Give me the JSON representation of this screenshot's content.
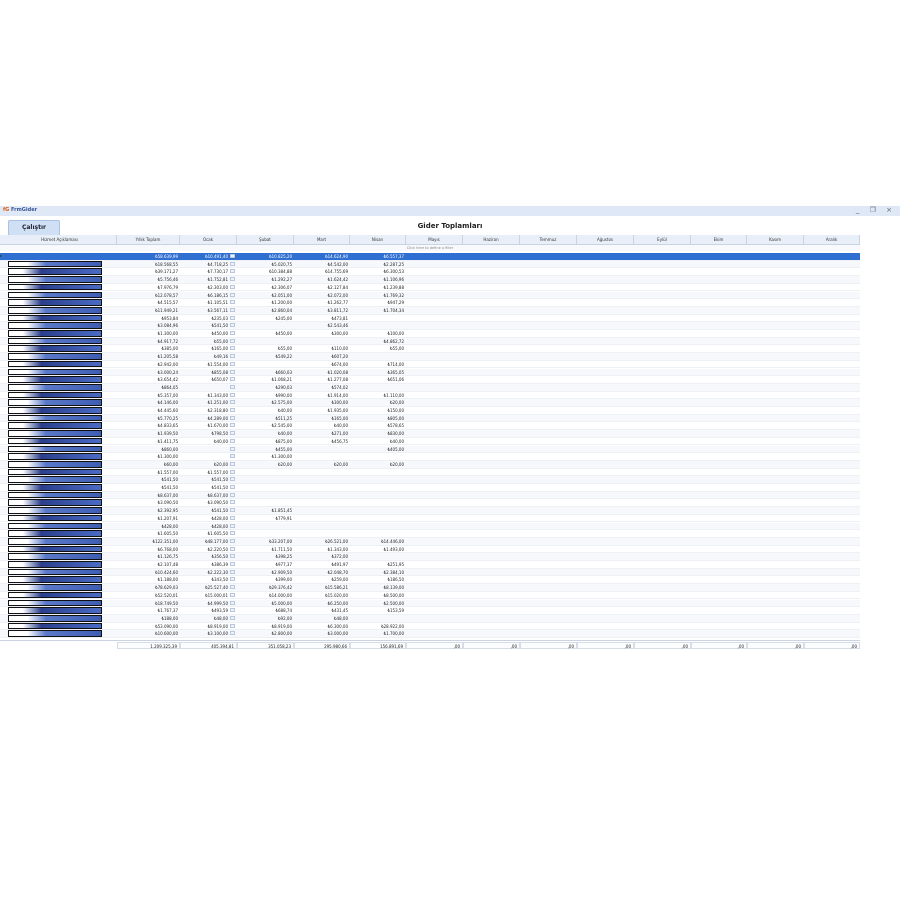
{
  "window": {
    "app_title": "FrmGider",
    "controls": "_ ❐ ×"
  },
  "toolbar": {
    "run_label": "Çalıştır",
    "report_title": "Gider Toplamları"
  },
  "grid": {
    "filter_hint": "Click here to define a filter",
    "columns": [
      "Hizmet Açıklaması",
      "Yıllık Toplam",
      "Ocak",
      "Şubat",
      "Mart",
      "Nisan",
      "Mayıs",
      "Haziran",
      "Temmuz",
      "Ağustos",
      "Eylül",
      "Ekim",
      "Kasım",
      "Aralık"
    ],
    "rows": [
      [
        "₺58.639,99",
        "₺10.491,40",
        "₺10.825,20",
        "₺14.624,90",
        "₺6.557,37"
      ],
      [
        "₺18.568,55",
        "₺4.718,25",
        "₺5.020,75",
        "₺4.542,00",
        "₺2.287,25"
      ],
      [
        "₺39.171,27",
        "₺7.730,17",
        "₺10.384,88",
        "₺14.755,69",
        "₺6.300,53"
      ],
      [
        "₺5.756,46",
        "₺1.752,81",
        "₺1.292,27",
        "₺1.624,42",
        "₺1.106,96"
      ],
      [
        "₺7.976,79",
        "₺2.303,00",
        "₺2.306,07",
        "₺2.127,84",
        "₺1.239,88"
      ],
      [
        "₺12.078,57",
        "₺6.186,15",
        "₺2.051,00",
        "₺2.072,00",
        "₺1.769,32"
      ],
      [
        "₺4.515,57",
        "₺1.105,51",
        "₺1.200,00",
        "₺1.262,77",
        "₺947,29"
      ],
      [
        "₺11.949,21",
        "₺3.567,11",
        "₺2.860,04",
        "₺3.811,72",
        "₺1.704,34"
      ],
      [
        "₺953,84",
        "₺235,03",
        "₺245,00",
        "₺473,81",
        ""
      ],
      [
        "₺3.084,96",
        "₺541,50",
        "",
        "₺2.543,46",
        ""
      ],
      [
        "₺1.300,00",
        "₺450,00",
        "₺450,00",
        "₺300,00",
        "₺100,00"
      ],
      [
        "₺4.917,72",
        "₺55,00",
        "",
        "",
        "₺4.862,72"
      ],
      [
        "₺385,00",
        "₺165,00",
        "₺55,00",
        "₺110,00",
        "₺55,00"
      ],
      [
        "₺1.205,58",
        "₺49,16",
        "₺549,22",
        "₺607,20",
        ""
      ],
      [
        "₺2.942,00",
        "₺1.554,00",
        "",
        "₺674,00",
        "₺714,00"
      ],
      [
        "₺3.000,24",
        "₺855,08",
        "₺660,03",
        "₺1.020,08",
        "₺365,05"
      ],
      [
        "₺3.654,42",
        "₺650,07",
        "₺1.068,21",
        "₺1.277,08",
        "₺651,06"
      ],
      [
        "₺864,05",
        "",
        "₺290,03",
        "₺574,02",
        ""
      ],
      [
        "₺5.357,00",
        "₺1.343,00",
        "₺990,00",
        "₺1.914,00",
        "₺1.110,00"
      ],
      [
        "₺4.146,00",
        "₺1.251,00",
        "₺2.575,00",
        "₺300,00",
        "₺20,00"
      ],
      [
        "₺4.445,60",
        "₺2.318,80",
        "₺40,00",
        "₺1.935,00",
        "₺150,00"
      ],
      [
        "₺5.770,25",
        "₺4.289,00",
        "₺511,25",
        "₺165,00",
        "₺805,00"
      ],
      [
        "₺4.833,65",
        "₺1.670,00",
        "₺2.545,00",
        "₺40,00",
        "₺578,65"
      ],
      [
        "₺1.939,50",
        "₺798,50",
        "₺40,00",
        "₺271,00",
        "₺830,00"
      ],
      [
        "₺1.411,75",
        "₺40,00",
        "₺875,00",
        "₺456,75",
        "₺40,00"
      ],
      [
        "₺860,00",
        "",
        "₺455,00",
        "",
        "₺405,00"
      ],
      [
        "₺1.300,00",
        "",
        "₺1.300,00",
        "",
        ""
      ],
      [
        "₺60,00",
        "₺20,00",
        "₺20,00",
        "₺20,00",
        "₺20,00"
      ],
      [
        "₺1.557,00",
        "₺1.557,00",
        "",
        "",
        ""
      ],
      [
        "₺541,50",
        "₺541,50",
        "",
        "",
        ""
      ],
      [
        "₺541,50",
        "₺541,50",
        "",
        "",
        ""
      ],
      [
        "₺8.637,00",
        "₺8.637,00",
        "",
        "",
        ""
      ],
      [
        "₺3.090,50",
        "₺3.090,50",
        "",
        "",
        ""
      ],
      [
        "₺2.392,95",
        "₺541,50",
        "₺1.851,45",
        "",
        ""
      ],
      [
        "₺1.207,91",
        "₺428,00",
        "₺779,91",
        "",
        ""
      ],
      [
        "₺428,00",
        "₺428,00",
        "",
        "",
        ""
      ],
      [
        "₺1.605,50",
        "₺1.605,50",
        "",
        "",
        ""
      ],
      [
        "₺122.351,00",
        "₺48.177,00",
        "₺33.207,00",
        "₺26.521,00",
        "₺14.446,00"
      ],
      [
        "₺6.768,00",
        "₺2.220,50",
        "₺1.711,50",
        "₺1.343,00",
        "₺1.493,00"
      ],
      [
        "₺1.126,75",
        "₺356,50",
        "₺398,25",
        "₺372,00",
        ""
      ],
      [
        "₺2.107,48",
        "₺386,39",
        "₺977,37",
        "₺491,97",
        "₺251,95"
      ],
      [
        "₺10.424,60",
        "₺2.222,30",
        "₺2.909,50",
        "₺2.048,70",
        "₺2.384,10"
      ],
      [
        "₺1.188,00",
        "₺343,50",
        "₺399,00",
        "₺259,00",
        "₺186,50"
      ],
      [
        "₺78.629,03",
        "₺25.527,40",
        "₺29.376,42",
        "₺15.586,21",
        "₺8.139,00"
      ],
      [
        "₺52.520,01",
        "₺15.000,01",
        "₺14.000,00",
        "₺15.020,00",
        "₺8.500,00"
      ],
      [
        "₺18.749,50",
        "₺4.999,50",
        "₺5.000,00",
        "₺6.250,00",
        "₺2.500,00"
      ],
      [
        "₺1.767,37",
        "₺493,59",
        "₺688,74",
        "₺431,45",
        "₺153,59"
      ],
      [
        "₺188,00",
        "₺48,00",
        "₺92,00",
        "₺48,00",
        ""
      ],
      [
        "₺53.090,00",
        "₺8.919,00",
        "₺8.919,00",
        "₺6.300,00",
        "₺28.922,00"
      ],
      [
        "₺10.600,00",
        "₺3.100,00",
        "₺2.800,00",
        "₺3.000,00",
        "₺1.700,00"
      ]
    ],
    "totals": [
      "1.209.325,39",
      "405.394,81",
      "351.058,23",
      "295.980,66",
      "156.891,69",
      ",00",
      ",00",
      ",00",
      ",00",
      ",00",
      ",00",
      ",00",
      ",00"
    ]
  }
}
